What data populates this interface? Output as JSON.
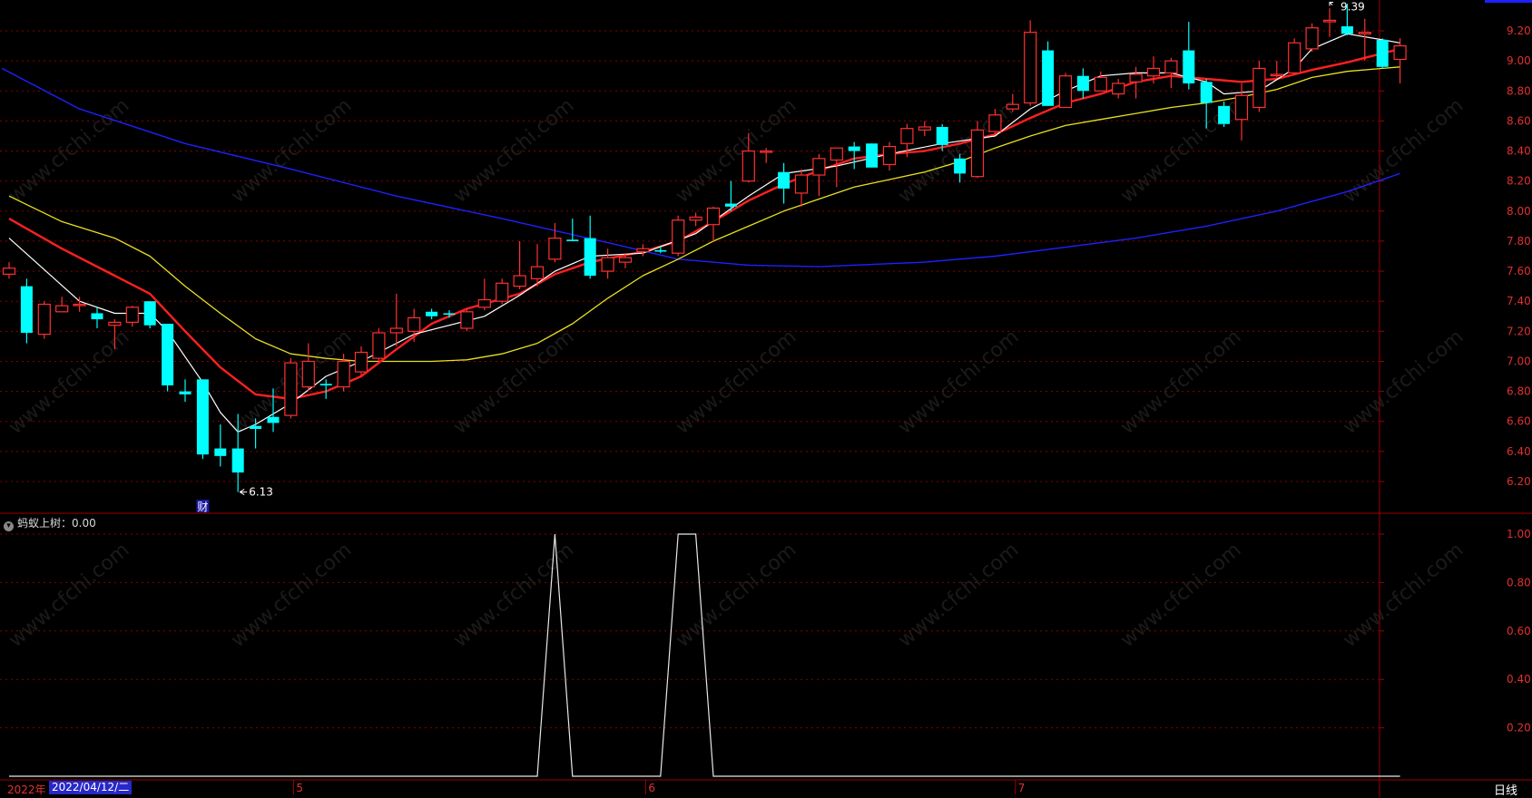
{
  "indicator": {
    "name": "蚂蚁上树",
    "value": "0.00"
  },
  "date_bar": {
    "year": "2022年",
    "date": "2022/04/12/二",
    "months": [
      "5",
      "6",
      "7"
    ]
  },
  "period_label": "日线",
  "event_marker": "财",
  "watermark": "www.cfchi.com",
  "colors": {
    "up": "#ff3030",
    "down": "#00ffff",
    "ma5": "#ffffff",
    "ma10": "#ff2020",
    "ma20": "#e8e020",
    "ma60": "#2020ff",
    "grid": "#8b0000",
    "axis_text": "#e03030"
  },
  "chart_data": [
    {
      "type": "candlestick",
      "title": "",
      "ylim": [
        6.05,
        9.42
      ],
      "yticks": [
        "6.20",
        "6.40",
        "6.60",
        "6.80",
        "7.00",
        "7.20",
        "7.40",
        "7.60",
        "7.80",
        "8.00",
        "8.20",
        "8.40",
        "8.60",
        "8.80",
        "9.00",
        "9.20"
      ],
      "annotations": {
        "low": "6.13",
        "high": "9.39"
      },
      "candles": [
        [
          7.58,
          7.66,
          7.55,
          7.62
        ],
        [
          7.5,
          7.55,
          7.12,
          7.19
        ],
        [
          7.18,
          7.4,
          7.15,
          7.38
        ],
        [
          7.33,
          7.43,
          7.33,
          7.37
        ],
        [
          7.38,
          7.43,
          7.33,
          7.38
        ],
        [
          7.32,
          7.36,
          7.22,
          7.28
        ],
        [
          7.24,
          7.28,
          7.08,
          7.26
        ],
        [
          7.26,
          7.37,
          7.23,
          7.36
        ],
        [
          7.4,
          7.4,
          7.22,
          7.24
        ],
        [
          7.25,
          7.25,
          6.8,
          6.84
        ],
        [
          6.8,
          6.88,
          6.73,
          6.78
        ],
        [
          6.88,
          6.88,
          6.35,
          6.38
        ],
        [
          6.42,
          6.58,
          6.3,
          6.37
        ],
        [
          6.42,
          6.65,
          6.13,
          6.26
        ],
        [
          6.57,
          6.62,
          6.42,
          6.55
        ],
        [
          6.63,
          6.82,
          6.53,
          6.59
        ],
        [
          6.64,
          7.02,
          6.62,
          6.99
        ],
        [
          6.83,
          7.12,
          6.8,
          7.0
        ],
        [
          6.85,
          6.88,
          6.75,
          6.84
        ],
        [
          6.83,
          7.05,
          6.8,
          7.0
        ],
        [
          6.93,
          7.1,
          6.9,
          7.06
        ],
        [
          7.02,
          7.22,
          7.0,
          7.19
        ],
        [
          7.19,
          7.45,
          7.1,
          7.22
        ],
        [
          7.2,
          7.35,
          7.13,
          7.29
        ],
        [
          7.33,
          7.35,
          7.28,
          7.3
        ],
        [
          7.32,
          7.34,
          7.29,
          7.31
        ],
        [
          7.22,
          7.35,
          7.2,
          7.33
        ],
        [
          7.36,
          7.55,
          7.34,
          7.41
        ],
        [
          7.4,
          7.55,
          7.38,
          7.52
        ],
        [
          7.5,
          7.8,
          7.48,
          7.57
        ],
        [
          7.55,
          7.78,
          7.5,
          7.63
        ],
        [
          7.68,
          7.92,
          7.66,
          7.82
        ],
        [
          7.81,
          7.95,
          7.8,
          7.8
        ],
        [
          7.82,
          7.97,
          7.55,
          7.57
        ],
        [
          7.6,
          7.75,
          7.55,
          7.69
        ],
        [
          7.66,
          7.72,
          7.62,
          7.69
        ],
        [
          7.73,
          7.78,
          7.7,
          7.75
        ],
        [
          7.74,
          7.77,
          7.72,
          7.73
        ],
        [
          7.72,
          7.97,
          7.7,
          7.94
        ],
        [
          7.94,
          7.99,
          7.9,
          7.96
        ],
        [
          7.91,
          8.03,
          7.8,
          8.02
        ],
        [
          8.05,
          8.2,
          8.0,
          8.03
        ],
        [
          8.2,
          8.52,
          8.19,
          8.4
        ],
        [
          8.4,
          8.42,
          8.32,
          8.4
        ],
        [
          8.26,
          8.32,
          8.05,
          8.15
        ],
        [
          8.12,
          8.28,
          8.03,
          8.24
        ],
        [
          8.24,
          8.38,
          8.1,
          8.35
        ],
        [
          8.34,
          8.42,
          8.16,
          8.42
        ],
        [
          8.43,
          8.46,
          8.28,
          8.4
        ],
        [
          8.45,
          8.45,
          8.29,
          8.29
        ],
        [
          8.31,
          8.46,
          8.27,
          8.43
        ],
        [
          8.45,
          8.58,
          8.36,
          8.55
        ],
        [
          8.54,
          8.6,
          8.5,
          8.56
        ],
        [
          8.56,
          8.58,
          8.4,
          8.44
        ],
        [
          8.35,
          8.38,
          8.19,
          8.25
        ],
        [
          8.23,
          8.6,
          8.22,
          8.54
        ],
        [
          8.53,
          8.68,
          8.51,
          8.64
        ],
        [
          8.68,
          8.78,
          8.66,
          8.71
        ],
        [
          8.72,
          9.27,
          8.7,
          9.19
        ],
        [
          9.07,
          9.13,
          8.72,
          8.7
        ],
        [
          8.69,
          8.92,
          8.7,
          8.9
        ],
        [
          8.9,
          8.95,
          8.75,
          8.8
        ],
        [
          8.8,
          8.93,
          8.8,
          8.89
        ],
        [
          8.78,
          8.88,
          8.75,
          8.85
        ],
        [
          8.86,
          8.96,
          8.75,
          8.91
        ],
        [
          8.9,
          9.03,
          8.85,
          8.95
        ],
        [
          8.92,
          9.02,
          8.82,
          9.0
        ],
        [
          9.07,
          9.26,
          8.81,
          8.85
        ],
        [
          8.86,
          8.88,
          8.55,
          8.72
        ],
        [
          8.7,
          8.73,
          8.56,
          8.58
        ],
        [
          8.61,
          8.85,
          8.47,
          8.77
        ],
        [
          8.69,
          9.0,
          8.66,
          8.95
        ],
        [
          8.91,
          9.0,
          8.89,
          8.91
        ],
        [
          8.92,
          9.15,
          8.91,
          9.12
        ],
        [
          9.08,
          9.25,
          9.06,
          9.22
        ],
        [
          9.26,
          9.35,
          9.16,
          9.27
        ],
        [
          9.23,
          9.38,
          9.17,
          9.18
        ],
        [
          9.18,
          9.28,
          9.0,
          9.19
        ],
        [
          9.14,
          9.15,
          8.95,
          8.96
        ],
        [
          9.01,
          9.15,
          8.85,
          9.1
        ]
      ],
      "ma5": [
        [
          0,
          7.82
        ],
        [
          4,
          7.4
        ],
        [
          6,
          7.32
        ],
        [
          8,
          7.32
        ],
        [
          9,
          7.2
        ],
        [
          11,
          6.86
        ],
        [
          12,
          6.66
        ],
        [
          13,
          6.53
        ],
        [
          14,
          6.58
        ],
        [
          16,
          6.72
        ],
        [
          18,
          6.9
        ],
        [
          20,
          7.0
        ],
        [
          23,
          7.18
        ],
        [
          27,
          7.3
        ],
        [
          29,
          7.44
        ],
        [
          31,
          7.6
        ],
        [
          33,
          7.7
        ],
        [
          36,
          7.72
        ],
        [
          39,
          7.85
        ],
        [
          42,
          8.1
        ],
        [
          44,
          8.25
        ],
        [
          47,
          8.3
        ],
        [
          50,
          8.38
        ],
        [
          53,
          8.45
        ],
        [
          56,
          8.5
        ],
        [
          58,
          8.68
        ],
        [
          60,
          8.8
        ],
        [
          62,
          8.9
        ],
        [
          64,
          8.92
        ],
        [
          66,
          8.92
        ],
        [
          68,
          8.86
        ],
        [
          69,
          8.78
        ],
        [
          71,
          8.8
        ],
        [
          73,
          8.95
        ],
        [
          74,
          9.08
        ],
        [
          76,
          9.18
        ],
        [
          78,
          9.14
        ],
        [
          79,
          9.12
        ]
      ],
      "ma10": [
        [
          0,
          7.95
        ],
        [
          3,
          7.75
        ],
        [
          6,
          7.57
        ],
        [
          8,
          7.45
        ],
        [
          10,
          7.2
        ],
        [
          12,
          6.96
        ],
        [
          14,
          6.78
        ],
        [
          16,
          6.75
        ],
        [
          18,
          6.8
        ],
        [
          20,
          6.9
        ],
        [
          22,
          7.08
        ],
        [
          24,
          7.25
        ],
        [
          26,
          7.35
        ],
        [
          29,
          7.45
        ],
        [
          31,
          7.58
        ],
        [
          33,
          7.66
        ],
        [
          36,
          7.73
        ],
        [
          38,
          7.8
        ],
        [
          40,
          7.93
        ],
        [
          42,
          8.07
        ],
        [
          44,
          8.18
        ],
        [
          46,
          8.27
        ],
        [
          48,
          8.35
        ],
        [
          50,
          8.38
        ],
        [
          52,
          8.4
        ],
        [
          54,
          8.45
        ],
        [
          56,
          8.51
        ],
        [
          58,
          8.62
        ],
        [
          60,
          8.72
        ],
        [
          62,
          8.78
        ],
        [
          64,
          8.86
        ],
        [
          66,
          8.9
        ],
        [
          68,
          8.88
        ],
        [
          70,
          8.86
        ],
        [
          72,
          8.88
        ],
        [
          74,
          8.94
        ],
        [
          76,
          8.99
        ],
        [
          78,
          9.05
        ],
        [
          79,
          9.08
        ]
      ],
      "ma20": [
        [
          0,
          8.1
        ],
        [
          3,
          7.93
        ],
        [
          6,
          7.82
        ],
        [
          8,
          7.7
        ],
        [
          10,
          7.5
        ],
        [
          12,
          7.32
        ],
        [
          14,
          7.15
        ],
        [
          16,
          7.05
        ],
        [
          18,
          7.02
        ],
        [
          20,
          7.0
        ],
        [
          22,
          7.0
        ],
        [
          24,
          7.0
        ],
        [
          26,
          7.01
        ],
        [
          28,
          7.05
        ],
        [
          30,
          7.12
        ],
        [
          32,
          7.25
        ],
        [
          34,
          7.42
        ],
        [
          36,
          7.57
        ],
        [
          38,
          7.68
        ],
        [
          40,
          7.8
        ],
        [
          42,
          7.9
        ],
        [
          44,
          8.0
        ],
        [
          46,
          8.08
        ],
        [
          48,
          8.16
        ],
        [
          50,
          8.21
        ],
        [
          52,
          8.26
        ],
        [
          54,
          8.33
        ],
        [
          56,
          8.42
        ],
        [
          58,
          8.5
        ],
        [
          60,
          8.57
        ],
        [
          62,
          8.61
        ],
        [
          64,
          8.65
        ],
        [
          66,
          8.69
        ],
        [
          68,
          8.72
        ],
        [
          70,
          8.76
        ],
        [
          72,
          8.81
        ],
        [
          74,
          8.89
        ],
        [
          76,
          8.93
        ],
        [
          79,
          8.96
        ]
      ],
      "ma60": [
        [
          -0.4,
          8.95
        ],
        [
          4,
          8.68
        ],
        [
          10,
          8.45
        ],
        [
          16,
          8.28
        ],
        [
          22,
          8.1
        ],
        [
          28,
          7.95
        ],
        [
          34,
          7.79
        ],
        [
          38,
          7.68
        ],
        [
          42,
          7.64
        ],
        [
          46,
          7.63
        ],
        [
          52,
          7.66
        ],
        [
          56,
          7.7
        ],
        [
          60,
          7.76
        ],
        [
          64,
          7.82
        ],
        [
          68,
          7.9
        ],
        [
          72,
          8.0
        ],
        [
          76,
          8.13
        ],
        [
          79,
          8.25
        ]
      ]
    },
    {
      "type": "line",
      "title": "",
      "ylim": [
        0,
        1.0
      ],
      "yticks": [
        "0.20",
        "0.40",
        "0.60",
        "0.80",
        "1.00"
      ],
      "values": [
        0,
        0,
        0,
        0,
        0,
        0,
        0,
        0,
        0,
        0,
        0,
        0,
        0,
        0,
        0,
        0,
        0,
        0,
        0,
        0,
        0,
        0,
        0,
        0,
        0,
        0,
        0,
        0,
        0,
        0,
        0,
        1,
        0,
        0,
        0,
        0,
        0,
        0,
        1,
        1,
        0,
        0,
        0,
        0,
        0,
        0,
        0,
        0,
        0,
        0,
        0,
        0,
        0,
        0,
        0,
        0,
        0,
        0,
        0,
        0,
        0,
        0,
        0,
        0,
        0,
        0,
        0,
        0,
        0,
        0,
        0,
        0,
        0,
        0,
        0,
        0,
        0,
        0,
        0,
        0
      ]
    }
  ]
}
